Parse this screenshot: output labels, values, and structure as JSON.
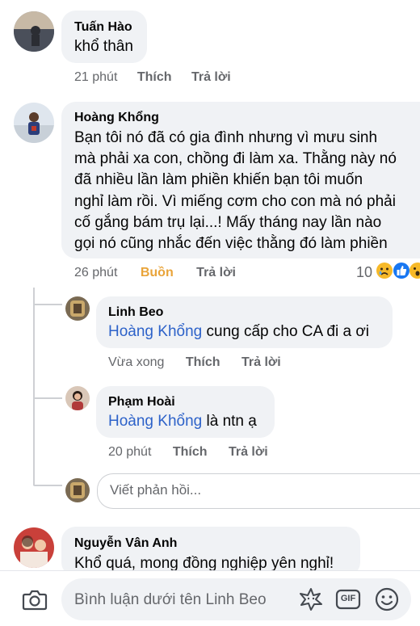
{
  "comments": [
    {
      "author": "Tuấn Hào",
      "text": "khổ thân",
      "time": "21 phút",
      "like": "Thích",
      "reply": "Trả lời"
    },
    {
      "author": "Hoàng Khổng",
      "lines": [
        "Bạn tôi nó đã có gia đình nhưng vì mưu sinh",
        "mà phải xa con, chồng đi làm xa. Thằng này nó",
        "đã nhiều lần làm phiền khiến bạn tôi muốn",
        "nghỉ làm rồi. Vì miếng cơm cho con mà nó phải",
        "cố gắng bám trụ lại...! Mấy tháng nay lần nào",
        "gọi nó cũng nhắc đến việc thằng đó làm phiền"
      ],
      "time": "26 phút",
      "reaction": "Buồn",
      "reply": "Trả lời",
      "reaction_count": "10"
    }
  ],
  "replies": [
    {
      "author": "Linh Beo",
      "mention": "Hoàng Khổng",
      "text": " cung cấp cho CA đi a ơi",
      "time": "Vừa xong",
      "like": "Thích",
      "reply": "Trả lời"
    },
    {
      "author": "Phạm Hoài",
      "mention": "Hoàng Khổng",
      "text": " là ntn ạ",
      "time": "20 phút",
      "like": "Thích",
      "reply": "Trả lời"
    }
  ],
  "reply_input": {
    "placeholder": "Viết phản hồi..."
  },
  "last_comment": {
    "author": "Nguyễn Vân Anh",
    "text": "Khổ quá, mong đồng nghiệp yên nghỉ!"
  },
  "composer": {
    "placeholder": "Bình luận dưới tên Linh Beo",
    "gif_label": "GIF"
  },
  "colors": {
    "mention": "#2d62c9",
    "bubble": "#f0f2f5",
    "meta": "#65676b",
    "sad_reaction": "#e9a43a"
  }
}
